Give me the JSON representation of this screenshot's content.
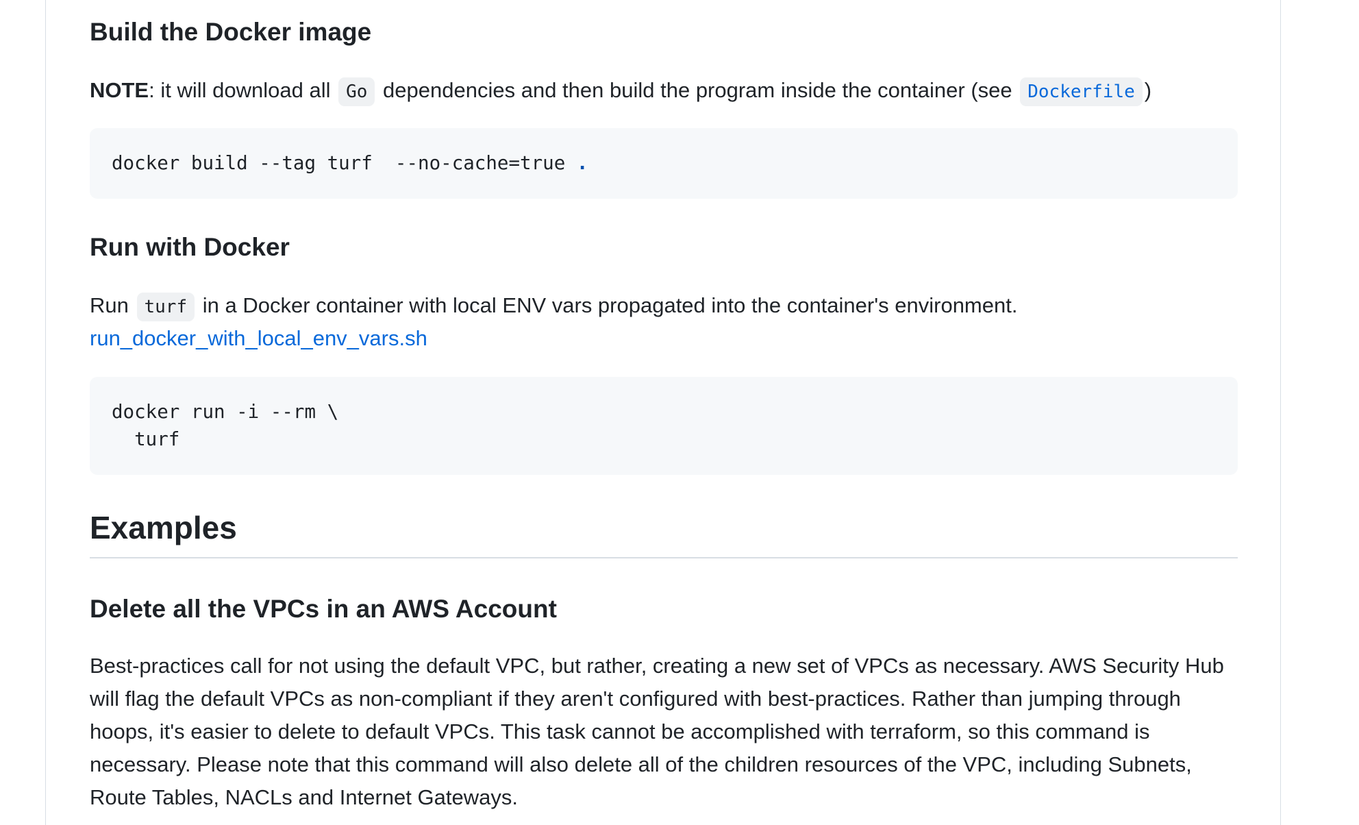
{
  "sections": {
    "build": {
      "heading": "Build the Docker image",
      "note_label": "NOTE",
      "note_text_1": ": it will download all",
      "code_go": "Go",
      "note_text_2": "dependencies and then build the program inside the container (see",
      "code_dockerfile": "Dockerfile",
      "note_text_3": ")",
      "command": "docker build --tag turf  --no-cache=true ",
      "command_dot": "."
    },
    "run": {
      "heading": "Run with Docker",
      "text_1": "Run",
      "code_turf": "turf",
      "text_2": "in a Docker container with local ENV vars propagated into the container's environment.",
      "link": "run_docker_with_local_env_vars.sh",
      "command_line_1": "docker run -i --rm \\",
      "command_line_2": "  turf"
    },
    "examples": {
      "heading": "Examples"
    },
    "delete_vpcs": {
      "heading": "Delete all the VPCs in an AWS Account",
      "paragraph": "Best-practices call for not using the default VPC, but rather, creating a new set of VPCs as necessary. AWS Security Hub will flag the default VPCs as non-compliant if they aren't configured with best-practices. Rather than jumping through hoops, it's easier to delete to default VPCs. This task cannot be accomplished with terraform, so this command is necessary. Please note that this command will also delete all of the children resources of the VPC, including Subnets, Route Tables, NACLs and Internet Gateways."
    }
  },
  "colors": {
    "text": "#1f2328",
    "link": "#0969da",
    "code_bg": "#f6f8fa",
    "inline_code_bg": "#eff1f3",
    "border": "#d8dee4"
  }
}
